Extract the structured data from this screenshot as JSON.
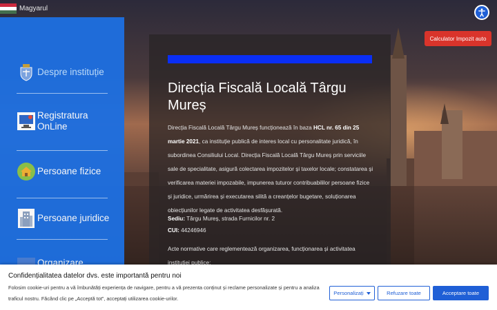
{
  "language": {
    "label": "Magyarul",
    "flag_colors": [
      "#cd2a3e",
      "#ffffff",
      "#436f4d"
    ]
  },
  "accessibility": {
    "icon": "accessibility-icon",
    "color": "#1f5fd6"
  },
  "calculator_button": {
    "label": "Calculator Impozit auto",
    "color": "#d9342b"
  },
  "sidebar": {
    "color": "#1e6fe0",
    "items": [
      {
        "label": "Despre instituție",
        "icon": "coat-of-arms-icon"
      },
      {
        "label": "Registratura OnLine",
        "icon": "computer-icon"
      },
      {
        "label": "Persoane fizice",
        "icon": "house-icon"
      },
      {
        "label": "Persoane juridice",
        "icon": "building-icon"
      },
      {
        "label": "Organizare",
        "icon": ""
      }
    ]
  },
  "panel": {
    "title": "Direcția Fiscală Locală Târgu Mureș",
    "intro_1": "Direcția Fiscală Locală Târgu Mureș funcționează în baza ",
    "intro_hcl": "HCL nr. 65 din 25 martie 2021",
    "intro_2": ", ca instituție publică de interes local cu personalitate juridică, în subordinea Consiliului Local. Direcția Fiscală Locală Târgu Mureș prin serviciile sale de specialitate, asigură colectarea impozitelor și taxelor locale; constatarea și verificarea materiei impozabile, impunerea tuturor contribuabililor persoane fizice și juridice, urmărirea și executarea silită a creanțelor bugetare, soluționarea obiecțiunilor legate de activitatea desfășurată.",
    "seat_label": "Sediu:",
    "seat_value": " Târgu Mureș, strada Furnicilor nr. 2",
    "cui_label": "CUI:",
    "cui_value": " 44246946",
    "acts_text": "Acte normative care reglementează organizarea, funcționarea și activitatea instituției publice:"
  },
  "cookie": {
    "title": "Confidențialitatea datelor dvs. este importantă pentru noi",
    "text": "Folosim cookie-uri pentru a vă îmbunătăți experiența de navigare, pentru a vă prezenta conținut și reclame personalizate și pentru a analiza traficul nostru. Făcând clic pe „Acceptă tot”, acceptați utilizarea cookie-urilor.",
    "customize_label": "Personalizați",
    "refuse_label": "Refuzare toate",
    "accept_label": "Acceptare toate",
    "accent": "#1f5fd6"
  }
}
